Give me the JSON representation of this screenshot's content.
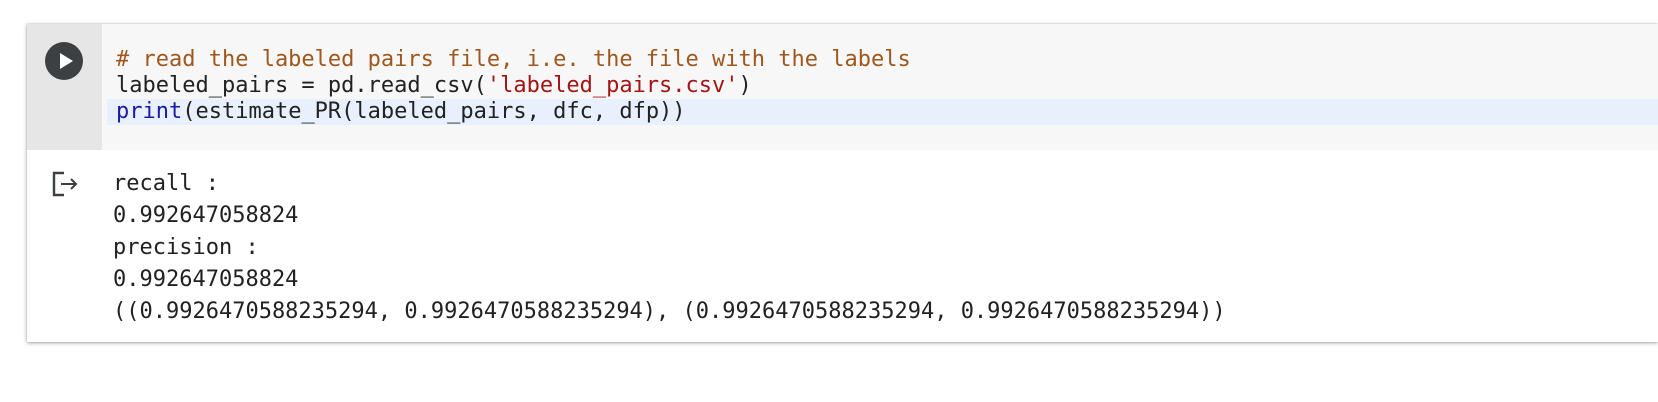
{
  "code_cell": {
    "run_button_icon": "play-icon",
    "lines": [
      {
        "comment": "# read the labeled pairs file, i.e. the file with the labels"
      },
      {
        "prefix": "labeled_pairs = pd.read_csv(",
        "string": "'labeled_pairs.csv'",
        "suffix": ")"
      },
      {
        "builtin": "print",
        "rest": "(estimate_PR(labeled_pairs, dfc, dfp))"
      }
    ]
  },
  "output": {
    "icon": "output-clear-icon",
    "lines": [
      "recall :",
      "0.992647058824",
      "precision :",
      "0.992647058824",
      "((0.9926470588235294, 0.9926470588235294), (0.9926470588235294, 0.9926470588235294))"
    ]
  }
}
